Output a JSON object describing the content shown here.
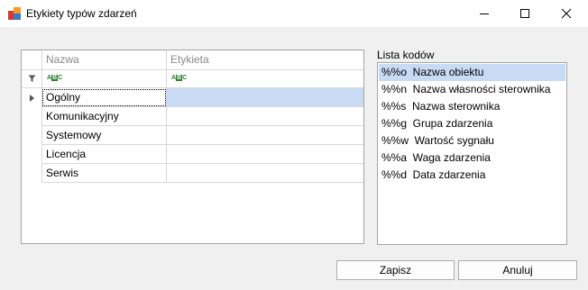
{
  "window": {
    "title": "Etykiety typów zdarzeń",
    "controls": {
      "minimize": "minimize-icon",
      "maximize": "maximize-icon",
      "close": "close-icon"
    }
  },
  "grid": {
    "columns": [
      "Nazwa",
      "Etykieta"
    ],
    "filter_row_icons": [
      "filter-icon",
      "text-filter-icon"
    ],
    "rows": [
      {
        "name": "Ogólny",
        "label": "",
        "selected": true
      },
      {
        "name": "Komunikacyjny",
        "label": ""
      },
      {
        "name": "Systemowy",
        "label": ""
      },
      {
        "name": "Licencja",
        "label": ""
      },
      {
        "name": "Serwis",
        "label": ""
      }
    ]
  },
  "codes": {
    "label": "Lista kodów",
    "items": [
      {
        "text": "%%o  Nazwa obiektu",
        "selected": true
      },
      {
        "text": "%%n  Nazwa własności sterownika"
      },
      {
        "text": "%%s  Nazwa sterownika"
      },
      {
        "text": "%%g  Grupa zdarzenia"
      },
      {
        "text": "%%w  Wartość sygnału"
      },
      {
        "text": "%%a  Waga zdarzenia"
      },
      {
        "text": "%%d  Data zdarzenia"
      }
    ]
  },
  "buttons": {
    "save": "Zapisz",
    "cancel": "Anuluj"
  },
  "colors": {
    "selection": "#c9daf5",
    "border": "#a5a5a5",
    "background": "#f0f0f0"
  }
}
